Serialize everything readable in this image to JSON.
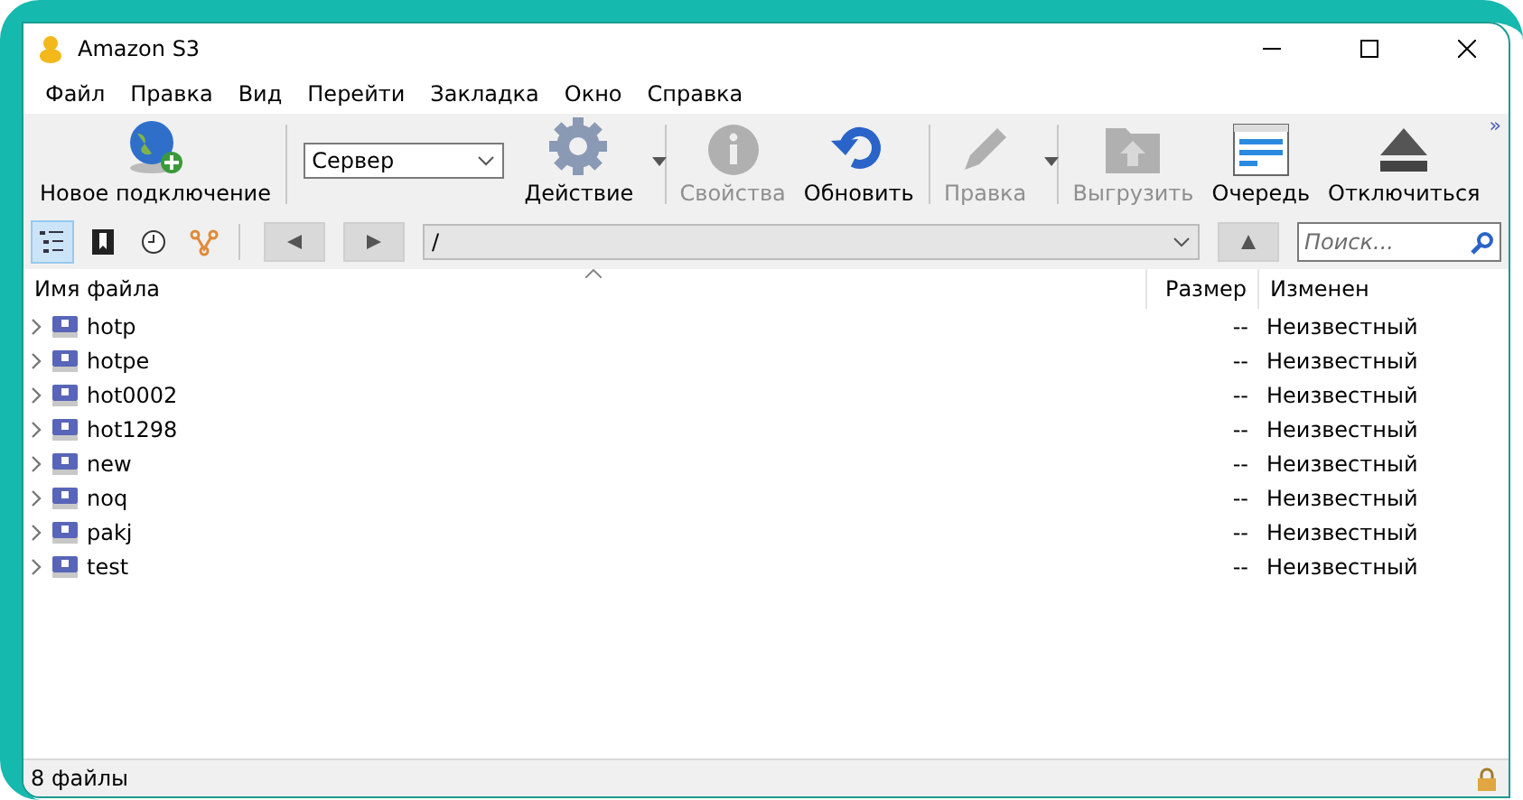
{
  "window": {
    "title": "Amazon S3"
  },
  "menu": [
    "Файл",
    "Правка",
    "Вид",
    "Перейти",
    "Закладка",
    "Окно",
    "Справка"
  ],
  "toolbar": {
    "new_connection": {
      "label": "Новое подключение",
      "disabled": false
    },
    "server": {
      "value": "Сервер"
    },
    "buttons": [
      {
        "kind": "action",
        "label": "Действие",
        "disabled": false,
        "dropdown": true
      },
      {
        "kind": "info",
        "label": "Свойства",
        "disabled": true,
        "dropdown": false
      },
      {
        "kind": "refresh",
        "label": "Обновить",
        "disabled": false,
        "dropdown": false
      },
      {
        "kind": "edit",
        "label": "Правка",
        "disabled": true,
        "dropdown": true
      },
      {
        "kind": "upload",
        "label": "Выгрузить",
        "disabled": true,
        "dropdown": false
      },
      {
        "kind": "queue",
        "label": "Очередь",
        "disabled": false,
        "dropdown": false
      },
      {
        "kind": "disconnect",
        "label": "Отключиться",
        "disabled": false,
        "dropdown": false
      }
    ],
    "overflow": "»"
  },
  "navbar": {
    "views": [
      {
        "kind": "browser",
        "selected": true
      },
      {
        "kind": "bookmarks",
        "selected": false
      },
      {
        "kind": "history",
        "selected": false
      },
      {
        "kind": "bonjour",
        "selected": false
      }
    ],
    "path": "/",
    "search": {
      "placeholder": "Поиск..."
    }
  },
  "table": {
    "columns": [
      {
        "label": "Имя файла",
        "sorted": true
      },
      {
        "label": "Размер",
        "sorted": false
      },
      {
        "label": "Изменен",
        "sorted": false
      }
    ],
    "rows": [
      {
        "name": "hotp",
        "size": "--",
        "modified": "Неизвестный"
      },
      {
        "name": "hotpe",
        "size": "--",
        "modified": "Неизвестный"
      },
      {
        "name": "hot0002",
        "size": "--",
        "modified": "Неизвестный"
      },
      {
        "name": "hot1298",
        "size": "--",
        "modified": "Неизвестный"
      },
      {
        "name": "new",
        "size": "--",
        "modified": "Неизвестный"
      },
      {
        "name": "noq",
        "size": "--",
        "modified": "Неизвестный"
      },
      {
        "name": "pakj",
        "size": "--",
        "modified": "Неизвестный"
      },
      {
        "name": "test",
        "size": "--",
        "modified": "Неизвестный"
      }
    ]
  },
  "status_bar": {
    "text": "8 файлы",
    "locked": true
  }
}
